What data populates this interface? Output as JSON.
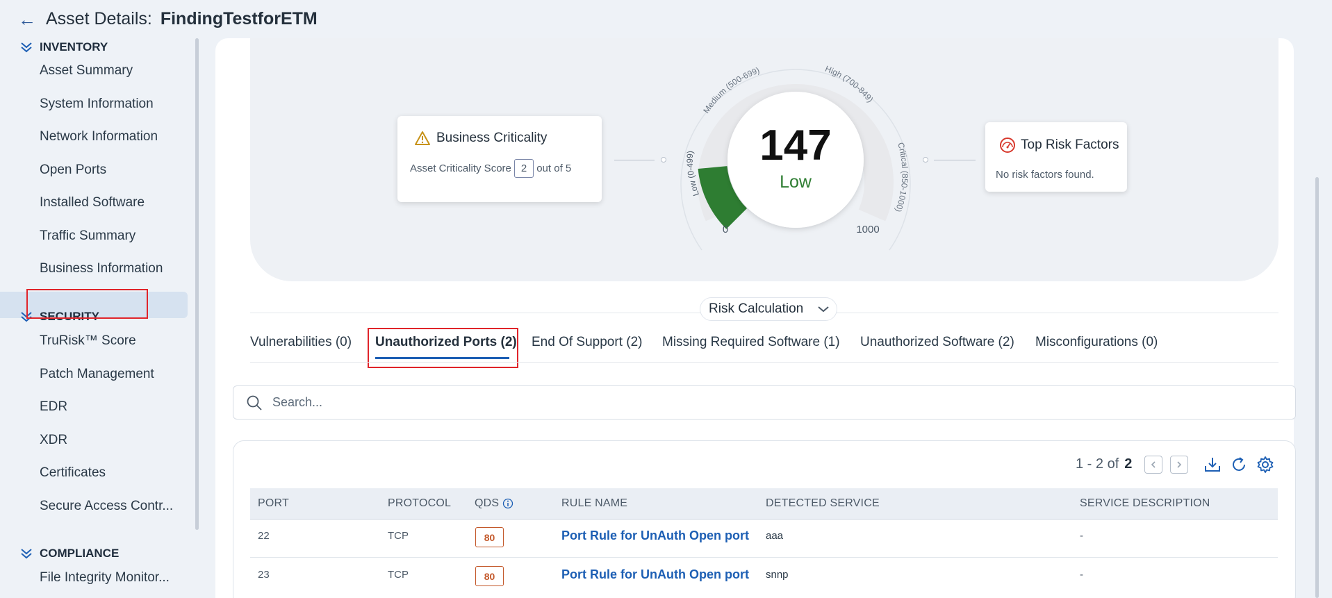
{
  "header": {
    "back_icon": "arrow-left-icon",
    "title": "Asset Details:",
    "asset_name": "FindingTestforETM"
  },
  "sidebar": {
    "sections": [
      {
        "label": "INVENTORY",
        "items": [
          "Asset Summary",
          "System Information",
          "Network Information",
          "Open Ports",
          "Installed Software",
          "Traffic Summary",
          "Business Information"
        ]
      },
      {
        "label": "SECURITY",
        "items": [
          "TruRisk™ Score",
          "Patch Management",
          "EDR",
          "XDR",
          "Certificates",
          "Secure Access Contr..."
        ]
      },
      {
        "label": "COMPLIANCE",
        "items": [
          "File Integrity Monitor..."
        ]
      }
    ],
    "active_item": "TruRisk™ Score"
  },
  "business_criticality": {
    "title": "Business Criticality",
    "label": "Asset Criticality Score",
    "score": "2",
    "suffix": "out of 5",
    "icon": "warning-icon"
  },
  "gauge": {
    "score": "147",
    "level": "Low",
    "value": 147,
    "min": 0,
    "max": 1000,
    "min_label": "0",
    "max_label": "1000",
    "bands": [
      "Low (0-499)",
      "Medium (500-699)",
      "High (700-849)",
      "Critical (850-1000)"
    ],
    "level_color": "#2e7d32",
    "fill_color": "#2e7d32"
  },
  "risk_factors": {
    "title": "Top Risk Factors",
    "message": "No risk factors found.",
    "icon": "speedometer-icon"
  },
  "risk_calculation": {
    "label": "Risk Calculation"
  },
  "tabs": [
    {
      "label": "Vulnerabilities (0)",
      "active": false
    },
    {
      "label": "Unauthorized Ports (2)",
      "active": true
    },
    {
      "label": "End Of Support (2)",
      "active": false
    },
    {
      "label": "Missing Required Software (1)",
      "active": false
    },
    {
      "label": "Unauthorized Software (2)",
      "active": false
    },
    {
      "label": "Misconfigurations (0)",
      "active": false
    }
  ],
  "search": {
    "placeholder": "Search..."
  },
  "pager": {
    "range": "1 - 2 of",
    "total": "2"
  },
  "table": {
    "columns": [
      "PORT",
      "PROTOCOL",
      "QDS",
      "RULE NAME",
      "DETECTED SERVICE",
      "SERVICE DESCRIPTION"
    ],
    "rows": [
      {
        "port": "22",
        "protocol": "TCP",
        "qds": "80",
        "rule": "Port Rule for UnAuth Open port",
        "service": "aaa",
        "description": "-"
      },
      {
        "port": "23",
        "protocol": "TCP",
        "qds": "80",
        "rule": "Port Rule for UnAuth Open port",
        "service": "snnp",
        "description": "-"
      }
    ]
  },
  "colors": {
    "accent": "#1d5fb4",
    "highlight": "#e0242a",
    "qds": "#c3582a"
  }
}
